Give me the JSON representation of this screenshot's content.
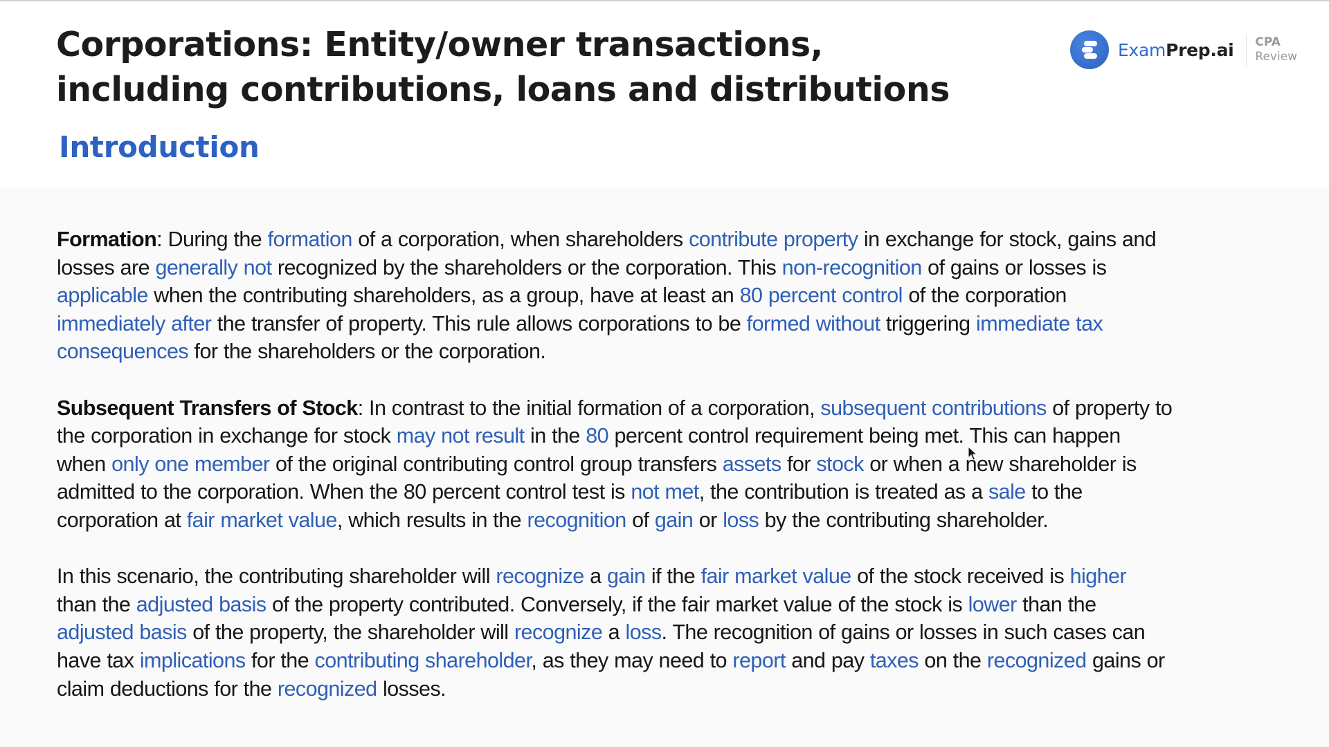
{
  "header": {
    "title_lines": [
      "Corporations: Entity/owner transactions,",
      "including contributions, loans and distributions"
    ],
    "subtitle": "Introduction"
  },
  "logo": {
    "brand_part1": "Exam",
    "brand_part2": "Prep.ai",
    "tag_line1": "CPA",
    "tag_line2": "Review",
    "brand_color": "#2f6bcc"
  },
  "colors": {
    "highlight": "#2e5fb7",
    "heading": "#2d62c4",
    "text": "#161616",
    "background": "#fafafa"
  },
  "paragraphs": [
    {
      "name": "formation",
      "lines": [
        [
          {
            "t": "Formation",
            "s": "b"
          },
          {
            "t": ": During the "
          },
          {
            "t": "formation",
            "s": "hl"
          },
          {
            "t": " of a corporation, when shareholders "
          },
          {
            "t": "contribute property",
            "s": "hl"
          },
          {
            "t": " in exchange for stock, gains and"
          }
        ],
        [
          {
            "t": "losses are "
          },
          {
            "t": "generally not",
            "s": "hl"
          },
          {
            "t": " recognized by the shareholders or the corporation. This "
          },
          {
            "t": "non-recognition",
            "s": "hl"
          },
          {
            "t": " of gains or losses is"
          }
        ],
        [
          {
            "t": "applicable",
            "s": "hl"
          },
          {
            "t": " when the contributing shareholders, as a group, have at least an "
          },
          {
            "t": "80 percent control",
            "s": "hl"
          },
          {
            "t": " of the corporation"
          }
        ],
        [
          {
            "t": "immediately after",
            "s": "hl"
          },
          {
            "t": " the transfer of property. This rule allows corporations to be "
          },
          {
            "t": "formed without",
            "s": "hl"
          },
          {
            "t": " triggering "
          },
          {
            "t": "immediate tax",
            "s": "hl"
          }
        ],
        [
          {
            "t": "consequences",
            "s": "hl"
          },
          {
            "t": " for the shareholders or the corporation."
          }
        ]
      ]
    },
    {
      "name": "subsequent-transfers",
      "lines": [
        [
          {
            "t": "Subsequent Transfers of Stock",
            "s": "b"
          },
          {
            "t": ": In contrast to the initial formation of a corporation, "
          },
          {
            "t": "subsequent contributions",
            "s": "hl"
          },
          {
            "t": " of property to"
          }
        ],
        [
          {
            "t": "the corporation in exchange for stock "
          },
          {
            "t": "may not result",
            "s": "hl"
          },
          {
            "t": " in the "
          },
          {
            "t": "80",
            "s": "hl"
          },
          {
            "t": " percent control requirement being met. This can happen"
          }
        ],
        [
          {
            "t": "when "
          },
          {
            "t": "only one member",
            "s": "hl"
          },
          {
            "t": " of the original contributing control group transfers "
          },
          {
            "t": "assets",
            "s": "hl"
          },
          {
            "t": " for "
          },
          {
            "t": "stock",
            "s": "hl"
          },
          {
            "t": " or when a new shareholder is"
          }
        ],
        [
          {
            "t": "admitted to the corporation. When the 80 percent control test is "
          },
          {
            "t": "not met",
            "s": "hl"
          },
          {
            "t": ", the contribution is treated as a "
          },
          {
            "t": "sale",
            "s": "hl"
          },
          {
            "t": " to the"
          }
        ],
        [
          {
            "t": "corporation at "
          },
          {
            "t": "fair market value",
            "s": "hl"
          },
          {
            "t": ", which results in the "
          },
          {
            "t": "recognition",
            "s": "hl"
          },
          {
            "t": " of "
          },
          {
            "t": "gain",
            "s": "hl"
          },
          {
            "t": " or "
          },
          {
            "t": "loss",
            "s": "hl"
          },
          {
            "t": " by the contributing shareholder."
          }
        ]
      ]
    },
    {
      "name": "scenario",
      "lines": [
        [
          {
            "t": "In this scenario, the contributing shareholder will "
          },
          {
            "t": "recognize",
            "s": "hl"
          },
          {
            "t": " a "
          },
          {
            "t": "gain",
            "s": "hl"
          },
          {
            "t": " if the "
          },
          {
            "t": "fair market value",
            "s": "hl"
          },
          {
            "t": " of the stock received is "
          },
          {
            "t": "higher",
            "s": "hl"
          }
        ],
        [
          {
            "t": "than the "
          },
          {
            "t": "adjusted basis",
            "s": "hl"
          },
          {
            "t": " of the property contributed. Conversely, if the fair market value of the stock is "
          },
          {
            "t": "lower",
            "s": "hl"
          },
          {
            "t": " than the"
          }
        ],
        [
          {
            "t": "adjusted basis",
            "s": "hl"
          },
          {
            "t": " of the property, the shareholder will "
          },
          {
            "t": "recognize",
            "s": "hl"
          },
          {
            "t": " a "
          },
          {
            "t": "loss",
            "s": "hl"
          },
          {
            "t": ". The recognition of gains or losses in such cases can"
          }
        ],
        [
          {
            "t": "have tax "
          },
          {
            "t": "implications",
            "s": "hl"
          },
          {
            "t": " for the "
          },
          {
            "t": "contributing shareholder",
            "s": "hl"
          },
          {
            "t": ", as they may need to "
          },
          {
            "t": "report",
            "s": "hl"
          },
          {
            "t": " and pay "
          },
          {
            "t": "taxes",
            "s": "hl"
          },
          {
            "t": " on the "
          },
          {
            "t": "recognized",
            "s": "hl"
          },
          {
            "t": " gains or"
          }
        ],
        [
          {
            "t": "claim deductions for the "
          },
          {
            "t": "recognized",
            "s": "hl"
          },
          {
            "t": " losses."
          }
        ]
      ]
    }
  ],
  "icons": {
    "logo": "exam-prep-logo-icon",
    "cursor": "mouse-pointer-icon"
  }
}
